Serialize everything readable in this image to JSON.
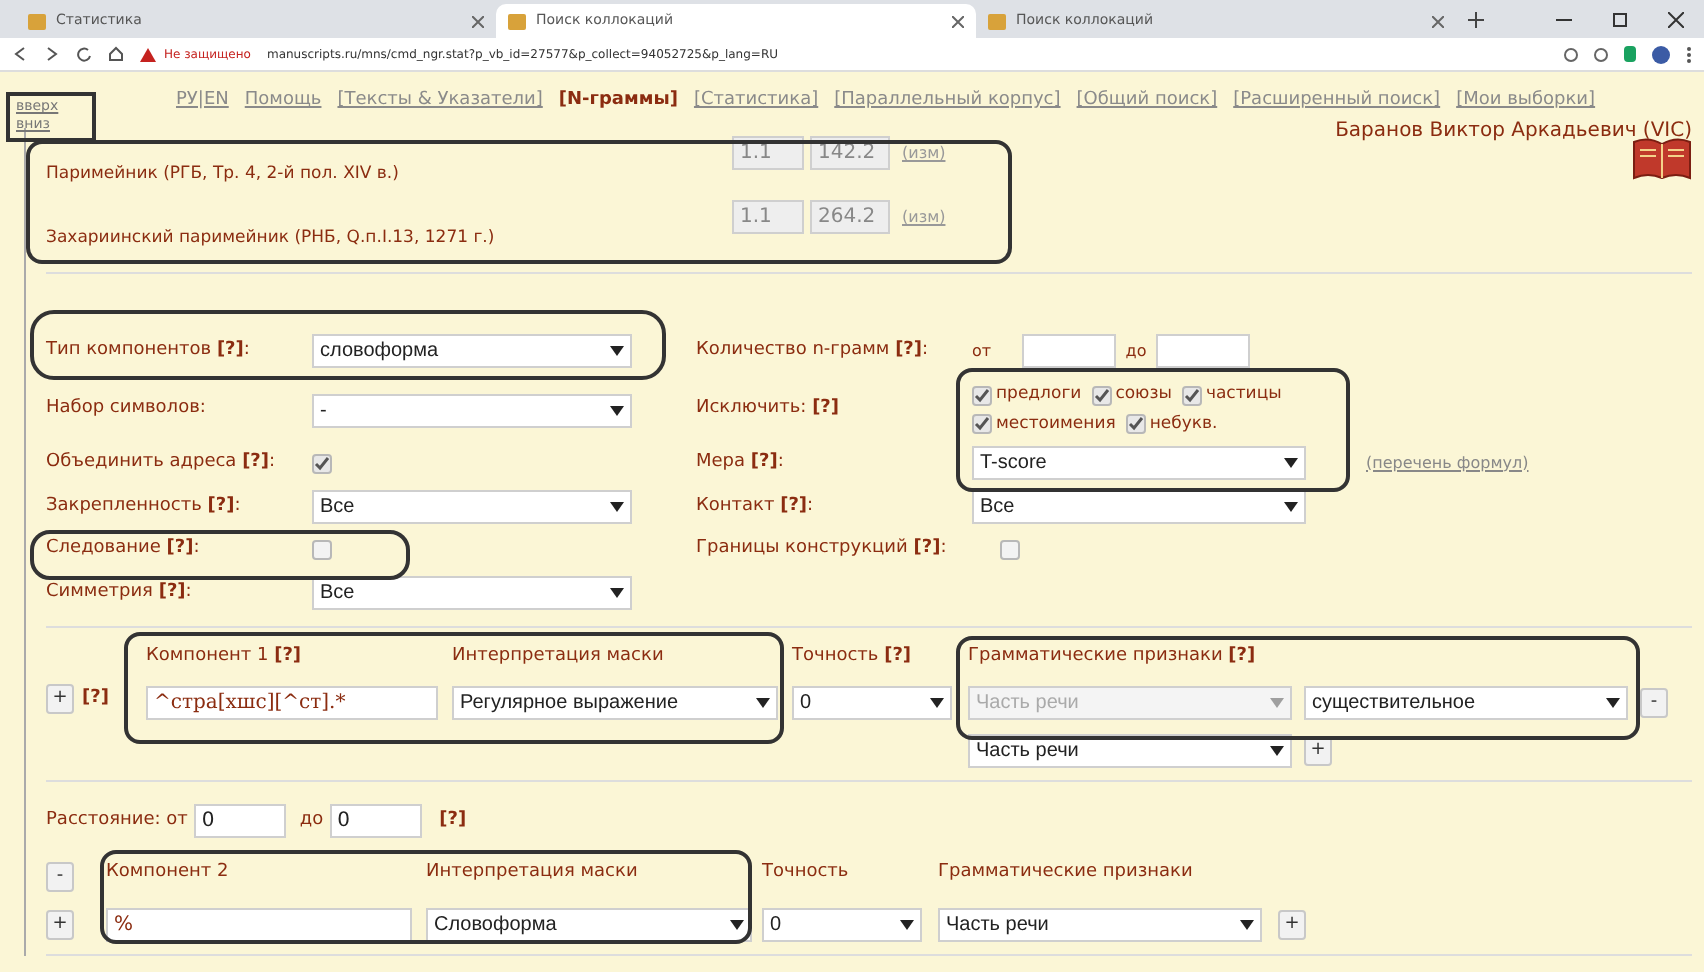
{
  "browser": {
    "tabs": [
      {
        "title": "Статистика",
        "selected": false
      },
      {
        "title": "Поиск коллокаций",
        "selected": true
      },
      {
        "title": "Поиск коллокаций",
        "selected": false
      }
    ],
    "address": {
      "security_label": "Не защищено",
      "url": "manuscripts.ru/mns/cmd_ngr.stat?p_vb_id=27577&p_collect=94052725&p_lang=RU"
    }
  },
  "scroll_links": [
    "вверх",
    "вниз"
  ],
  "nav": {
    "links": [
      {
        "label": "РУ|EN",
        "selected": false
      },
      {
        "label": "Помощь",
        "selected": false
      },
      {
        "label": "[Тексты & Указатели]",
        "selected": false
      },
      {
        "label": "[N-граммы]",
        "selected": true
      },
      {
        "label": "[Статистика]",
        "selected": false
      },
      {
        "label": "[Параллельный корпус]",
        "selected": false
      },
      {
        "label": "[Общий поиск]",
        "selected": false
      },
      {
        "label": "[Расширенный поиск]",
        "selected": false
      },
      {
        "label": "[Мои выборки]",
        "selected": false
      }
    ],
    "user_name": "Баранов Виктор Аркадьевич (VIC)"
  },
  "manuscripts": [
    {
      "title": "Паримейник (РГБ, Тр. 4, 2-й пол. XIV в.)",
      "from": "1.1",
      "to": "142.2",
      "action": "(изм)"
    },
    {
      "title": "Захариинский паримейник (РНБ, Q.п.I.13, 1271 г.)",
      "from": "1.1",
      "to": "264.2",
      "action": "(изм)"
    }
  ],
  "settings_left": [
    {
      "kind": "select",
      "label": "Тип компонентов **[?]**:",
      "value": "словоформа"
    },
    {
      "kind": "select",
      "label": "Набор символов:",
      "value": "-"
    },
    {
      "kind": "checkbox",
      "label": "Объединить адреса **[?]**:",
      "checked": true
    },
    {
      "kind": "select",
      "label": "Закрепленность **[?]**:",
      "value": "Все"
    },
    {
      "kind": "checkbox",
      "label": "Следование **[?]**:",
      "checked": false
    },
    {
      "kind": "select",
      "label": "Симметрия **[?]**:",
      "value": "Все"
    }
  ],
  "settings_right": {
    "ngram_count": {
      "label": "Количество n-грамм **[?]**:",
      "from_label": "от",
      "to_label": "до"
    },
    "exclude": {
      "label": "Исключить: **[?]**",
      "options": [
        {
          "label": "предлоги",
          "checked": true
        },
        {
          "label": "союзы",
          "checked": true
        },
        {
          "label": "частицы",
          "checked": true
        },
        {
          "label": "местоимения",
          "checked": true
        },
        {
          "label": "небукв.",
          "checked": true
        }
      ]
    },
    "measure": {
      "label": "Мера  **[?]**:",
      "value": "T-score",
      "link": "(перечень формул)"
    },
    "contact": {
      "label": "Контакт **[?]**:",
      "value": "Все"
    },
    "constructions": {
      "label": "Границы конструкций  **[?]**:",
      "checked": false
    }
  },
  "component_1": {
    "add_button": "+",
    "help": "[?]",
    "label": "Компонент 1 **[?]**",
    "mask_label": "Интерпретация маски",
    "accuracy_label": "Точность  **[?]**",
    "grammar_label": "Грамматические признаки  **[?]**",
    "value": "^стра[хшс][^ст].*",
    "mask_value": "Регулярное выражение",
    "accuracy_value": "0",
    "grammar_selects": [
      {
        "value": "Часть речи",
        "disabled": true
      },
      {
        "value": "существительное",
        "disabled": false
      }
    ],
    "remove_button": "-",
    "extra_select": "Часть речи",
    "extra_add_button": "+"
  },
  "distance": {
    "label": "Расстояние: от",
    "from": "0",
    "to_label": "до",
    "to": "0",
    "help": "[?]"
  },
  "component_2": {
    "remove_button": "-",
    "add_button": "+",
    "label": "Компонент 2",
    "mask_label": "Интерпретация маски",
    "accuracy_label": "Точность",
    "grammar_label": "Грамматические признаки",
    "value": "%",
    "mask_value": "Словоформа",
    "accuracy_value": "0",
    "grammar_value": "Часть речи",
    "grammar_add_button": "+"
  }
}
